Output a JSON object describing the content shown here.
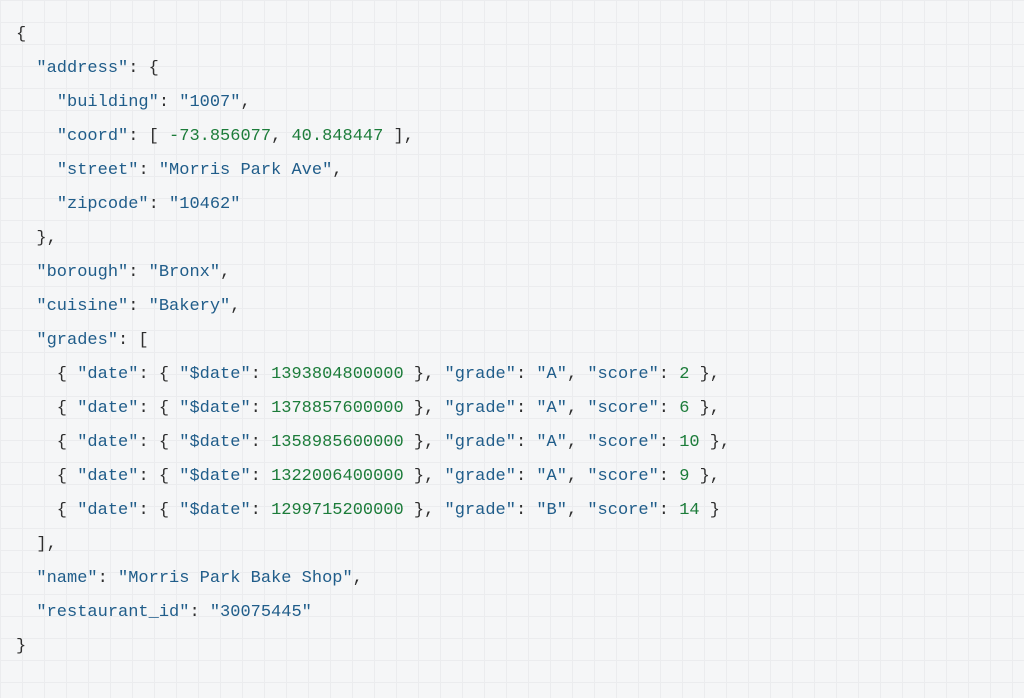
{
  "code": {
    "lines": [
      [
        [
          "p",
          "{"
        ]
      ],
      [
        [
          "p",
          "  "
        ],
        [
          "k",
          "\"address\""
        ],
        [
          "p",
          ": {"
        ]
      ],
      [
        [
          "p",
          "    "
        ],
        [
          "k",
          "\"building\""
        ],
        [
          "p",
          ": "
        ],
        [
          "s",
          "\"1007\""
        ],
        [
          "p",
          ","
        ]
      ],
      [
        [
          "p",
          "    "
        ],
        [
          "k",
          "\"coord\""
        ],
        [
          "p",
          ": [ "
        ],
        [
          "n",
          "-73.856077"
        ],
        [
          "p",
          ", "
        ],
        [
          "n",
          "40.848447"
        ],
        [
          "p",
          " ],"
        ]
      ],
      [
        [
          "p",
          "    "
        ],
        [
          "k",
          "\"street\""
        ],
        [
          "p",
          ": "
        ],
        [
          "s",
          "\"Morris Park Ave\""
        ],
        [
          "p",
          ","
        ]
      ],
      [
        [
          "p",
          "    "
        ],
        [
          "k",
          "\"zipcode\""
        ],
        [
          "p",
          ": "
        ],
        [
          "s",
          "\"10462\""
        ]
      ],
      [
        [
          "p",
          "  },"
        ]
      ],
      [
        [
          "p",
          "  "
        ],
        [
          "k",
          "\"borough\""
        ],
        [
          "p",
          ": "
        ],
        [
          "s",
          "\"Bronx\""
        ],
        [
          "p",
          ","
        ]
      ],
      [
        [
          "p",
          "  "
        ],
        [
          "k",
          "\"cuisine\""
        ],
        [
          "p",
          ": "
        ],
        [
          "s",
          "\"Bakery\""
        ],
        [
          "p",
          ","
        ]
      ],
      [
        [
          "p",
          "  "
        ],
        [
          "k",
          "\"grades\""
        ],
        [
          "p",
          ": ["
        ]
      ],
      [
        [
          "p",
          "    { "
        ],
        [
          "k",
          "\"date\""
        ],
        [
          "p",
          ": { "
        ],
        [
          "k",
          "\"$date\""
        ],
        [
          "p",
          ": "
        ],
        [
          "n",
          "1393804800000"
        ],
        [
          "p",
          " }, "
        ],
        [
          "k",
          "\"grade\""
        ],
        [
          "p",
          ": "
        ],
        [
          "s",
          "\"A\""
        ],
        [
          "p",
          ", "
        ],
        [
          "k",
          "\"score\""
        ],
        [
          "p",
          ": "
        ],
        [
          "n",
          "2"
        ],
        [
          "p",
          " },"
        ]
      ],
      [
        [
          "p",
          "    { "
        ],
        [
          "k",
          "\"date\""
        ],
        [
          "p",
          ": { "
        ],
        [
          "k",
          "\"$date\""
        ],
        [
          "p",
          ": "
        ],
        [
          "n",
          "1378857600000"
        ],
        [
          "p",
          " }, "
        ],
        [
          "k",
          "\"grade\""
        ],
        [
          "p",
          ": "
        ],
        [
          "s",
          "\"A\""
        ],
        [
          "p",
          ", "
        ],
        [
          "k",
          "\"score\""
        ],
        [
          "p",
          ": "
        ],
        [
          "n",
          "6"
        ],
        [
          "p",
          " },"
        ]
      ],
      [
        [
          "p",
          "    { "
        ],
        [
          "k",
          "\"date\""
        ],
        [
          "p",
          ": { "
        ],
        [
          "k",
          "\"$date\""
        ],
        [
          "p",
          ": "
        ],
        [
          "n",
          "1358985600000"
        ],
        [
          "p",
          " }, "
        ],
        [
          "k",
          "\"grade\""
        ],
        [
          "p",
          ": "
        ],
        [
          "s",
          "\"A\""
        ],
        [
          "p",
          ", "
        ],
        [
          "k",
          "\"score\""
        ],
        [
          "p",
          ": "
        ],
        [
          "n",
          "10"
        ],
        [
          "p",
          " },"
        ]
      ],
      [
        [
          "p",
          "    { "
        ],
        [
          "k",
          "\"date\""
        ],
        [
          "p",
          ": { "
        ],
        [
          "k",
          "\"$date\""
        ],
        [
          "p",
          ": "
        ],
        [
          "n",
          "1322006400000"
        ],
        [
          "p",
          " }, "
        ],
        [
          "k",
          "\"grade\""
        ],
        [
          "p",
          ": "
        ],
        [
          "s",
          "\"A\""
        ],
        [
          "p",
          ", "
        ],
        [
          "k",
          "\"score\""
        ],
        [
          "p",
          ": "
        ],
        [
          "n",
          "9"
        ],
        [
          "p",
          " },"
        ]
      ],
      [
        [
          "p",
          "    { "
        ],
        [
          "k",
          "\"date\""
        ],
        [
          "p",
          ": { "
        ],
        [
          "k",
          "\"$date\""
        ],
        [
          "p",
          ": "
        ],
        [
          "n",
          "1299715200000"
        ],
        [
          "p",
          " }, "
        ],
        [
          "k",
          "\"grade\""
        ],
        [
          "p",
          ": "
        ],
        [
          "s",
          "\"B\""
        ],
        [
          "p",
          ", "
        ],
        [
          "k",
          "\"score\""
        ],
        [
          "p",
          ": "
        ],
        [
          "n",
          "14"
        ],
        [
          "p",
          " }"
        ]
      ],
      [
        [
          "p",
          "  ],"
        ]
      ],
      [
        [
          "p",
          "  "
        ],
        [
          "k",
          "\"name\""
        ],
        [
          "p",
          ": "
        ],
        [
          "s",
          "\"Morris Park Bake Shop\""
        ],
        [
          "p",
          ","
        ]
      ],
      [
        [
          "p",
          "  "
        ],
        [
          "k",
          "\"restaurant_id\""
        ],
        [
          "p",
          ": "
        ],
        [
          "s",
          "\"30075445\""
        ]
      ],
      [
        [
          "p",
          "}"
        ]
      ]
    ]
  }
}
